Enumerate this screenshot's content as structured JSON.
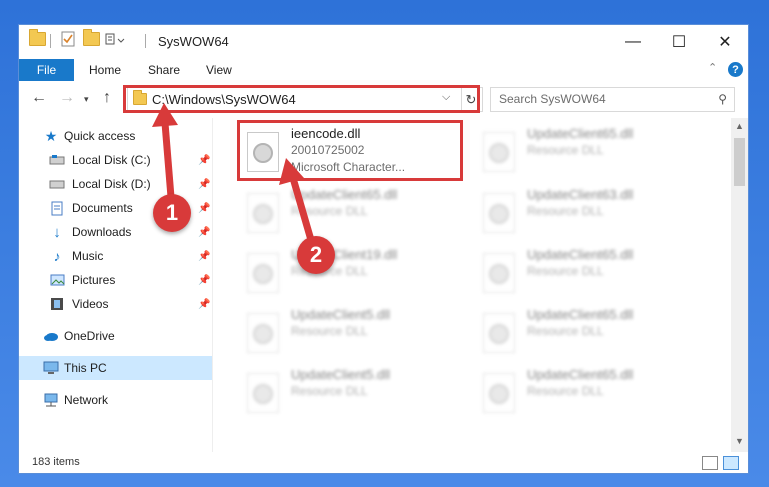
{
  "window": {
    "title": "SysWOW64"
  },
  "ribbon": {
    "file": "File",
    "home": "Home",
    "share": "Share",
    "view": "View",
    "help": "?"
  },
  "controls": {
    "minimize": "—",
    "maximize": "☐",
    "close": "✕"
  },
  "address": {
    "path": "C:\\Windows\\SysWOW64",
    "refresh": "↻",
    "dropdown": "⌵"
  },
  "search": {
    "placeholder": "Search SysWOW64"
  },
  "nav": {
    "quick_access": "Quick access",
    "items": [
      "Local Disk (C:)",
      "Local Disk (D:)",
      "Documents",
      "Downloads",
      "Music",
      "Pictures",
      "Videos"
    ],
    "onedrive": "OneDrive",
    "this_pc": "This PC",
    "network": "Network"
  },
  "files": {
    "highlighted": {
      "name": "ieencode.dll",
      "version": "20010725002",
      "desc": "Microsoft Character..."
    },
    "left_col": [
      {
        "name": "UpdateClient65.dll",
        "desc": "Resource DLL"
      },
      {
        "name": "UpdateClient19.dll",
        "desc": "Resource DLL"
      },
      {
        "name": "UpdateClient5.dll",
        "desc": "Resource DLL"
      },
      {
        "name": "UpdateClient5.dll",
        "desc": "Resource DLL"
      }
    ],
    "right_col": [
      {
        "name": "UpdateClient65.dll",
        "desc": "Resource DLL"
      },
      {
        "name": "UpdateClient63.dll",
        "desc": "Resource DLL"
      },
      {
        "name": "UpdateClient65.dll",
        "desc": "Resource DLL"
      },
      {
        "name": "UpdateClient65.dll",
        "desc": "Resource DLL"
      },
      {
        "name": "UpdateClient65.dll",
        "desc": "Resource DLL"
      }
    ]
  },
  "status": {
    "count": "183 items"
  },
  "annotations": {
    "badge1": "1",
    "badge2": "2",
    "color": "#d83a3a"
  }
}
